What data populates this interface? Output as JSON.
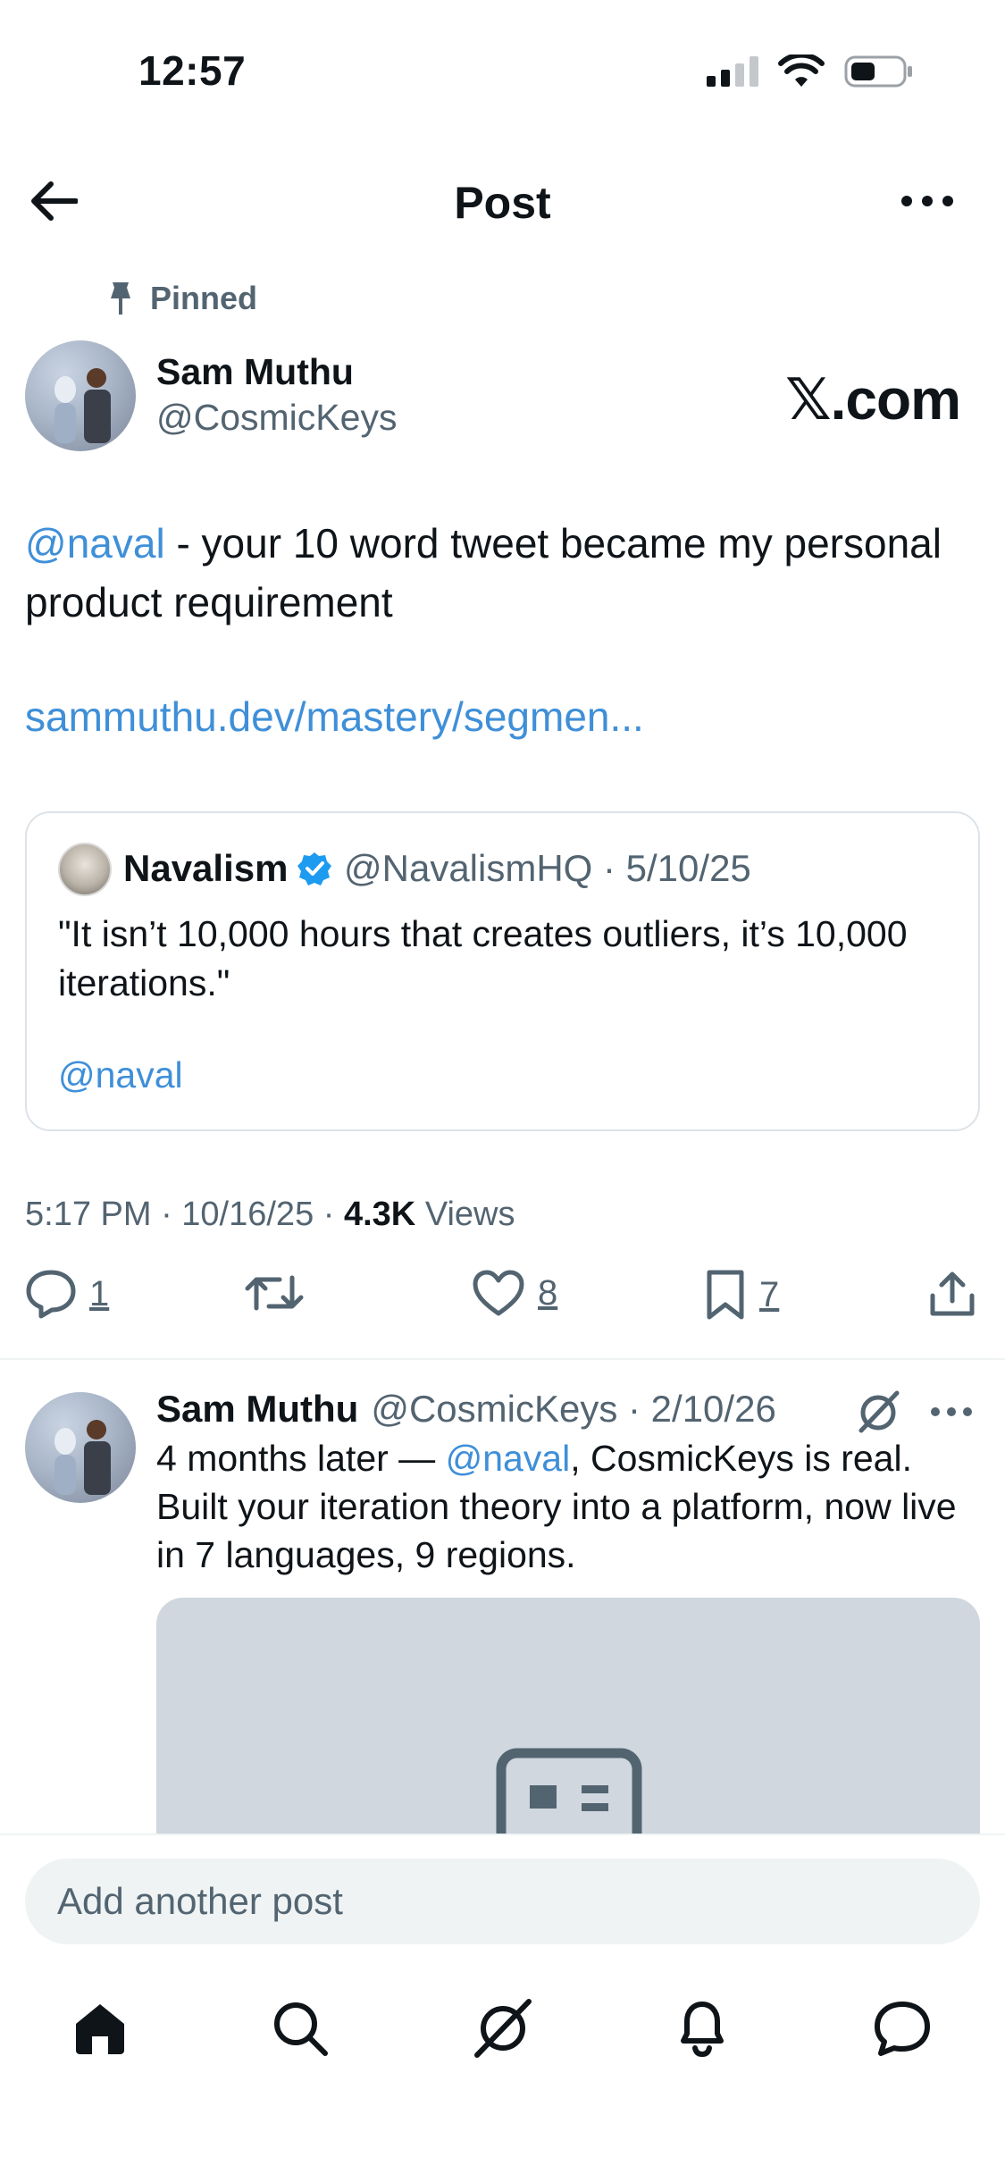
{
  "status_bar": {
    "time": "12:57"
  },
  "header": {
    "title": "Post"
  },
  "pinned_label": "Pinned",
  "author": {
    "name": "Sam Muthu",
    "handle": "@CosmicKeys"
  },
  "watermark": "𝕏.com",
  "post": {
    "mention": "@naval",
    "text": " - your 10 word tweet became my personal product requirement",
    "link": "sammuthu.dev/mastery/segmen..."
  },
  "quote": {
    "name": "Navalism",
    "meta": "@NavalismHQ · 5/10/25",
    "text": "\"It isn’t 10,000 hours that creates outliers, it’s 10,000 iterations.\"",
    "mention": "@naval"
  },
  "timestamp": {
    "time": "5:17 PM · 10/16/25 · ",
    "views_count": "4.3K",
    "views_label": " Views"
  },
  "actions": {
    "replies": "1",
    "reposts": "",
    "likes": "8",
    "bookmarks": "7"
  },
  "reply": {
    "name": "Sam Muthu",
    "meta": "@CosmicKeys · 2/10/26",
    "text_prefix": "4 months later — ",
    "mention": "@naval",
    "text_suffix": ", CosmicKeys is real. Built your iteration theory into a platform, now live in 7 languages, 9 regions."
  },
  "composer": {
    "placeholder": "Add another post"
  },
  "nav": [
    "home-icon",
    "search-icon",
    "grok-icon",
    "notifications-icon",
    "messages-icon"
  ],
  "colors": {
    "accent_link": "#3f8fd8",
    "secondary_text": "#536471",
    "verified": "#1d9bf0"
  }
}
